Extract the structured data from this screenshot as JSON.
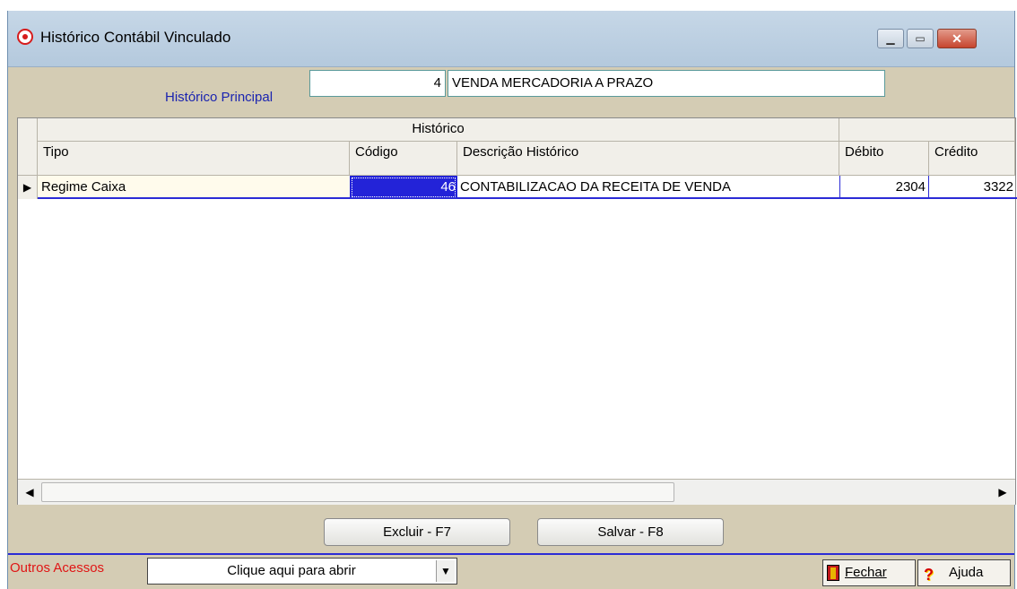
{
  "window": {
    "title": "Histórico Contábil Vinculado",
    "min_symbol": "▁",
    "max_symbol": "▭",
    "close_symbol": "✕"
  },
  "historico_principal": {
    "label": "Histórico Principal",
    "code": "4",
    "description": "VENDA MERCADORIA A PRAZO"
  },
  "grid": {
    "group_header": "Histórico",
    "columns": [
      "Tipo",
      "Código",
      "Descrição Histórico",
      "Débito",
      "Crédito"
    ],
    "rows": [
      {
        "indicator": "▶",
        "tipo": "Regime Caixa",
        "codigo": "46",
        "descricao": "CONTABILIZACAO DA RECEITA DE VENDA",
        "debito": "2304",
        "credito": "3322"
      }
    ],
    "scroll_left": "◀",
    "scroll_right": "▶"
  },
  "buttons": {
    "excluir": "Excluir - F7",
    "salvar": "Salvar - F8"
  },
  "footer": {
    "outros_acessos_label": "Outros Acessos",
    "combo_value": "Clique aqui para abrir",
    "combo_arrow": "▼",
    "fechar_label": "Fechar",
    "ajuda_label": "Ajuda",
    "ajuda_icon": "?"
  },
  "colors": {
    "accent_blue": "#1b24b0",
    "selection": "#2b2bd6",
    "warning_red": "#e01515",
    "panel": "#d4ccb4"
  }
}
